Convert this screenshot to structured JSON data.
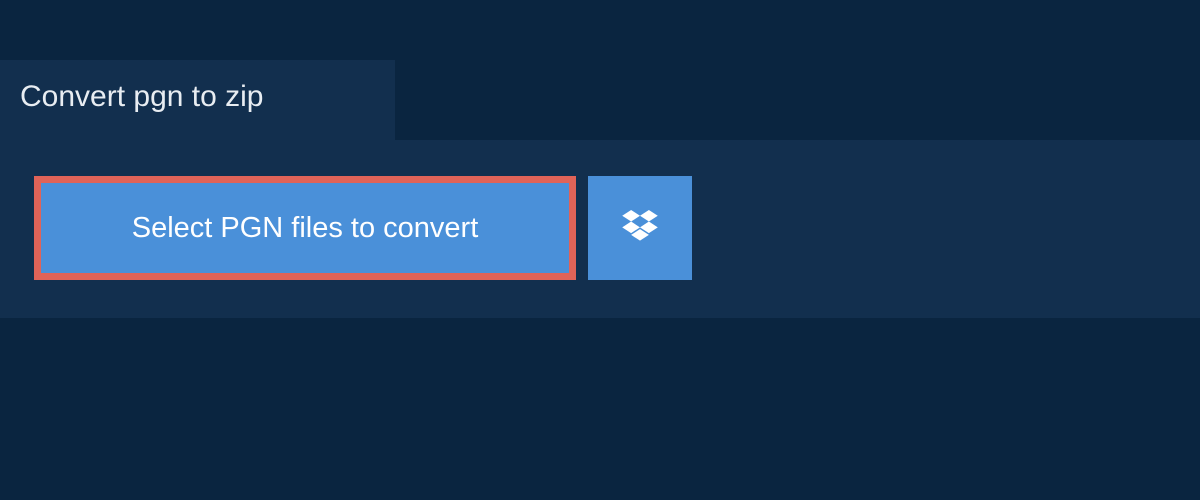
{
  "header": {
    "tab_label": "Convert pgn to zip"
  },
  "actions": {
    "select_button_label": "Select PGN files to convert"
  },
  "colors": {
    "page_bg": "#0a2540",
    "panel_bg": "#122f4e",
    "button_bg": "#4a90d9",
    "highlight_border": "#e06358",
    "text_light": "#ffffff"
  }
}
